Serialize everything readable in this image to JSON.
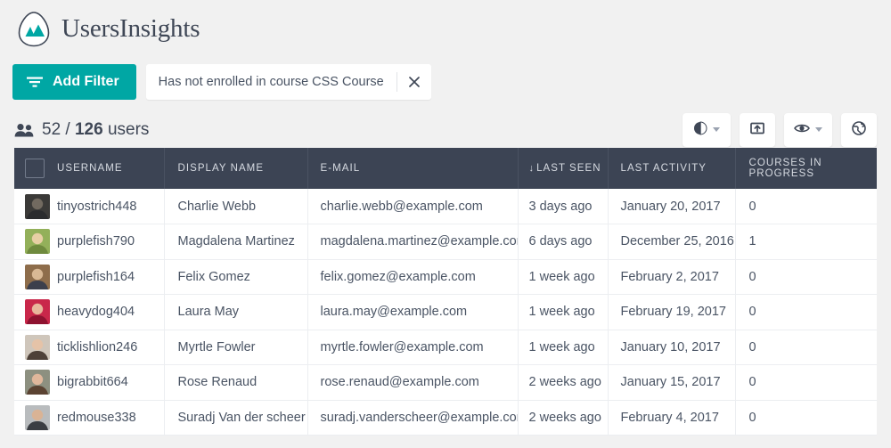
{
  "brand": {
    "name": "UsersInsights",
    "logo_icon": "mountain-logo-icon"
  },
  "filterbar": {
    "add_filter_label": "Add Filter",
    "add_filter_icon": "filter-icon",
    "chip": {
      "label": "Has not enrolled in course CSS Course",
      "close_icon": "close-icon"
    }
  },
  "count": {
    "icon": "users-icon",
    "shown": "52",
    "separator": "/",
    "total": "126",
    "suffix": "users"
  },
  "tools": [
    {
      "name": "charts-button",
      "icon": "pie-chart-icon",
      "has_caret": true
    },
    {
      "name": "export-button",
      "icon": "export-icon",
      "has_caret": false
    },
    {
      "name": "visibility-button",
      "icon": "eye-icon",
      "has_caret": true
    },
    {
      "name": "map-button",
      "icon": "globe-icon",
      "has_caret": false
    }
  ],
  "table": {
    "select_all_icon": "checkbox-unchecked-icon",
    "sort_indicator": "↓",
    "columns": [
      {
        "key": "username",
        "label": "USERNAME"
      },
      {
        "key": "display_name",
        "label": "DISPLAY NAME"
      },
      {
        "key": "email",
        "label": "E-MAIL"
      },
      {
        "key": "last_seen",
        "label": "LAST SEEN",
        "sorted": true
      },
      {
        "key": "last_activity",
        "label": "LAST ACTIVITY"
      },
      {
        "key": "courses_in_progress",
        "label": "COURSES IN PROGRESS"
      }
    ],
    "rows": [
      {
        "username": "tinyostrich448",
        "display_name": "Charlie Webb",
        "email": "charlie.webb@example.com",
        "last_seen": "3 days ago",
        "last_activity": "January 20, 2017",
        "courses_in_progress": "0",
        "avatar_colors": [
          "#3b3a38",
          "#726a60",
          "#2b2c2e"
        ]
      },
      {
        "username": "purplefish790",
        "display_name": "Magdalena Martinez",
        "email": "magdalena.martinez@example.com",
        "last_seen": "6 days ago",
        "last_activity": "December 25, 2016",
        "courses_in_progress": "1",
        "avatar_colors": [
          "#93b05a",
          "#e7cfa4",
          "#6f8a3e"
        ]
      },
      {
        "username": "purplefish164",
        "display_name": "Felix Gomez",
        "email": "felix.gomez@example.com",
        "last_seen": "1 week ago",
        "last_activity": "February 2, 2017",
        "courses_in_progress": "0",
        "avatar_colors": [
          "#8e6d4b",
          "#d8b894",
          "#3c3f4c"
        ]
      },
      {
        "username": "heavydog404",
        "display_name": "Laura May",
        "email": "laura.may@example.com",
        "last_seen": "1 week ago",
        "last_activity": "February 19, 2017",
        "courses_in_progress": "0",
        "avatar_colors": [
          "#c9274a",
          "#e8b69c",
          "#8e1230"
        ]
      },
      {
        "username": "ticklishlion246",
        "display_name": "Myrtle Fowler",
        "email": "myrtle.fowler@example.com",
        "last_seen": "1 week ago",
        "last_activity": "January 10, 2017",
        "courses_in_progress": "0",
        "avatar_colors": [
          "#cfc6bb",
          "#e5c3a8",
          "#4d4038"
        ]
      },
      {
        "username": "bigrabbit664",
        "display_name": "Rose Renaud",
        "email": "rose.renaud@example.com",
        "last_seen": "2 weeks ago",
        "last_activity": "January 15, 2017",
        "courses_in_progress": "0",
        "avatar_colors": [
          "#8d9080",
          "#e0b79b",
          "#5b4332"
        ]
      },
      {
        "username": "redmouse338",
        "display_name": "Suradj Van der scheer",
        "email": "suradj.vanderscheer@example.com",
        "last_seen": "2 weeks ago",
        "last_activity": "February 4, 2017",
        "courses_in_progress": "0",
        "avatar_colors": [
          "#b9bcbe",
          "#d9b395",
          "#3a3d42"
        ]
      }
    ]
  },
  "colors": {
    "accent_teal": "#00a7a4",
    "header_dark": "#3c4454",
    "page_bg": "#f1f1f1",
    "text": "#4a5464"
  }
}
